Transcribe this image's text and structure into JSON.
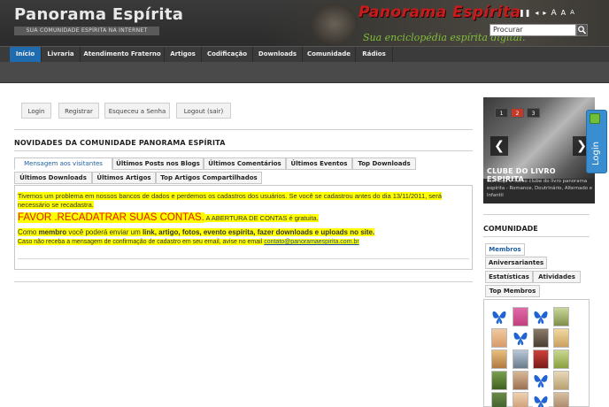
{
  "header": {
    "title": "Panorama Espírita",
    "tagline": "SUA COMUNIDADE ESPÍRITA NA INTERNET",
    "banner_title": "Panorama Espírita",
    "banner_subtitle": "Sua enciclopédia espírita digital.",
    "media_controls": [
      "❚❚",
      "◂",
      "▸",
      "A",
      "A",
      "A"
    ],
    "search_value": "Procurar",
    "search_icon": "search-icon"
  },
  "nav": {
    "items": [
      "Início",
      "Livraria",
      "Atendimento Fraterno",
      "Artigos",
      "Codificação",
      "Downloads",
      "Comunidade",
      "Rádios"
    ],
    "active_color": "#1e6bb0"
  },
  "auth_buttons": [
    "Login",
    "Registrar",
    "Esqueceu a Senha",
    "Logout (sair)"
  ],
  "main": {
    "section_title": "NOVIDADES DA COMUNIDADE PANORAMA ESPÍRITA",
    "tabs_row1": [
      "Mensagem aos visitantes",
      "Últimos Posts nos Blogs",
      "Últimos Comentários",
      "Últimos Eventos",
      "Top Downloads"
    ],
    "tabs_row2": [
      "Últimos Downloads",
      "Últimos Artigos",
      "Top Artigos Compartilhados"
    ],
    "message": {
      "line1": "Tivemos um problema em nossos bancos de dados e perdemos os cadastros dos usuários. Se você se cadastrou antes do dia 13/11/2011, será",
      "line1b": "necessário se recadastra.",
      "big": "FAVOR .RECADATRAR SUAS CONTAS.",
      "big_after": " A ABERTURA DE CONTAS é gratuita.",
      "line3_a": "Como ",
      "line3_b": "membro",
      "line3_c": " você poderá enviar um ",
      "line3_d": "link, artigo, fotos, evento espírita, fazer downloads e uploads no site.",
      "line4": "Caso não receba a mensagem de confirmação de cadastro em seu email, avise no email ",
      "email": "contato@panoramaespirita.com.br"
    }
  },
  "slider": {
    "numbers": [
      "1",
      "2",
      "3"
    ],
    "active_number": "2",
    "prev": "❮",
    "next": "❯",
    "caption_title": "CLUBE DO LIVRO ESPIRITA",
    "caption_text": "Conheça o nosso clube do livro panorama espírita - Romance, Doutrinário, Alternado e Infantil"
  },
  "login_tab": "Login",
  "community": {
    "title": "COMUNIDADE",
    "tabs": [
      "Membros",
      "Aniversariantes",
      "Estatísticas",
      "Atividades",
      "Top Membros"
    ]
  }
}
